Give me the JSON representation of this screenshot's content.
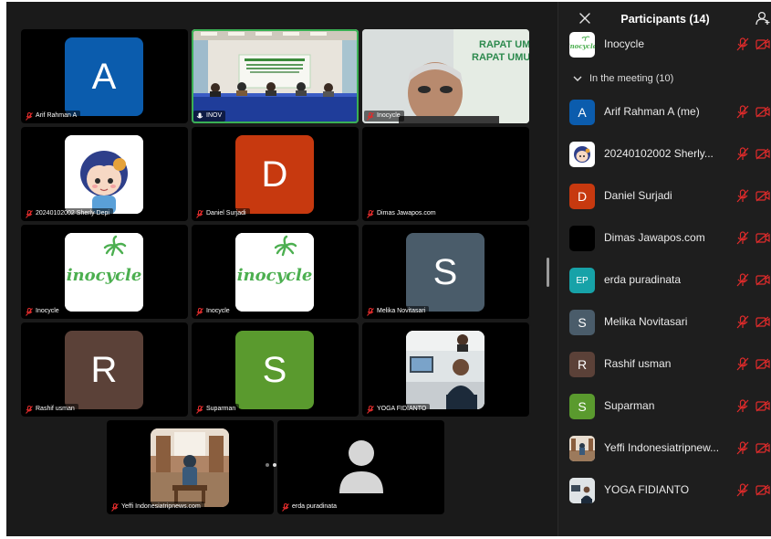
{
  "panel": {
    "title": "Participants (14)",
    "section_label": "In the meeting (10)",
    "participants": [
      {
        "name": "Inocycle",
        "avatar": "inocycle-logo"
      },
      {
        "name": "Arif Rahman A (me)",
        "initial": "A",
        "color": "#0b5cad"
      },
      {
        "name": "20240102002 Sherly...",
        "avatar": "cartoon-girl"
      },
      {
        "name": "Daniel Surjadi",
        "initial": "D",
        "color": "#c7390f"
      },
      {
        "name": "Dimas Jawapos.com",
        "initial": "",
        "color": "#000000"
      },
      {
        "name": "erda puradinata",
        "initial": "EP",
        "color": "#17a2a8"
      },
      {
        "name": "Melika Novitasari",
        "initial": "S",
        "color": "#4a5c6a"
      },
      {
        "name": "Rashif usman",
        "initial": "R",
        "color": "#5b4138"
      },
      {
        "name": "Suparman",
        "initial": "S",
        "color": "#5a9a2e"
      },
      {
        "name": "Yeffi Indonesiatripnew...",
        "avatar": "photo"
      },
      {
        "name": "YOGA FIDIANTO",
        "avatar": "photo"
      }
    ]
  },
  "tiles": [
    {
      "name": "Arif Rahman A",
      "initial": "A",
      "color": "#0b5cad"
    },
    {
      "name": "INOV",
      "kind": "video-meeting-room"
    },
    {
      "name": "Inocycle",
      "kind": "video-person"
    },
    {
      "name": "20240102002 Sherly Depi",
      "kind": "cartoon"
    },
    {
      "name": "Daniel Surjadi",
      "initial": "D",
      "color": "#c7390f"
    },
    {
      "name": "Dimas Jawapos.com",
      "kind": "blank"
    },
    {
      "name": "Inocycle",
      "kind": "logo"
    },
    {
      "name": "Inocycle",
      "kind": "logo"
    },
    {
      "name": "Melika Novitasari",
      "initial": "S",
      "color": "#4a5c6a"
    },
    {
      "name": "Rashif usman",
      "initial": "R",
      "color": "#5b4138"
    },
    {
      "name": "Suparman",
      "initial": "S",
      "color": "#5a9a2e"
    },
    {
      "name": "YOGA FIDIANTO",
      "kind": "video-office"
    },
    {
      "name": "Yeffi Indonesiatripnews.com",
      "kind": "video-room"
    },
    {
      "name": "erda puradinata",
      "kind": "default-avatar"
    }
  ],
  "logo_text": "inocycle",
  "banner_text": {
    "line1": "RAPAT UM",
    "line2": "RAPAT UMU"
  },
  "colors": {
    "mute_red": "#e02b2b",
    "active_border": "#3ab054",
    "icon_gray": "#8a8a8a"
  },
  "pager": {
    "pages": 2,
    "current": 2
  }
}
